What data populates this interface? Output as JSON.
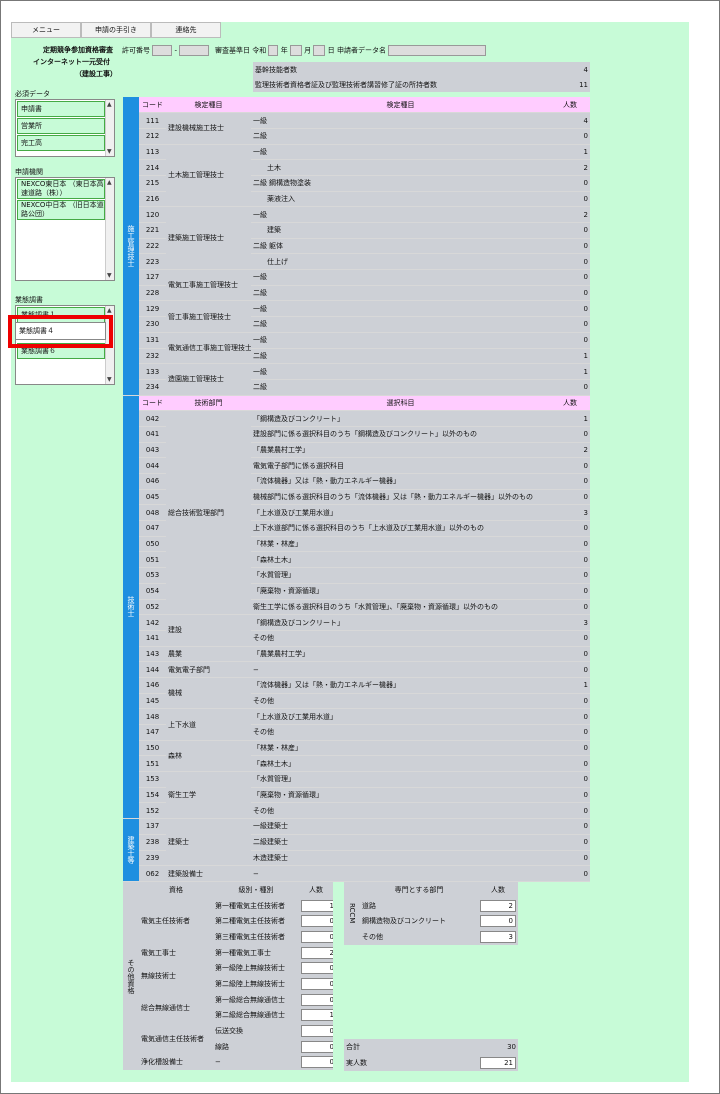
{
  "menu": {
    "items": [
      "メニュー",
      "申請の手引き",
      "連絡先"
    ]
  },
  "header": {
    "title1": "定期競争参加資格審査",
    "title2": "インターネット一元受付",
    "title3": "（建設工事）",
    "permit_label": "許可番号",
    "dash": "-",
    "kijun_label": "審査基準日",
    "era": "令和",
    "year": "年",
    "month": "月",
    "day": "日",
    "applicant_label": "申請者データ名"
  },
  "sidebar": {
    "required_label": "必須データ",
    "required_items": [
      "申請書",
      "営業所",
      "完工高"
    ],
    "agency_label": "申請機関",
    "agency_items": [
      "NEXCO東日本 （東日本高速道路（株））",
      "NEXCO中日本 （旧日本道路公団）"
    ],
    "survey_label": "業態調書",
    "survey_items": [
      "業態調書１",
      "業態調書４",
      "業態調書６"
    ]
  },
  "summary": [
    {
      "label": "基幹技能者数",
      "value": "4"
    },
    {
      "label": "監理技術者資格者証及び監理技術者講習修了証の所持者数",
      "value": "11"
    }
  ],
  "sec1": {
    "vertical": "施工管理技士",
    "headers": [
      "コード",
      "検定種目",
      "検定種目",
      "人数"
    ],
    "rows": [
      {
        "code": "111",
        "name": "建設機械施工技士",
        "span": 2,
        "sub": "一級",
        "grade": "",
        "count": "4"
      },
      {
        "code": "212",
        "sub": "二級",
        "grade": "",
        "count": "0"
      },
      {
        "code": "113",
        "name": "土木施工管理技士",
        "span": 4,
        "sub": "一級",
        "grade": "",
        "count": "1"
      },
      {
        "code": "214",
        "sub": "",
        "grade": "土木",
        "count": "2"
      },
      {
        "code": "215",
        "sub": "二級",
        "grade": "鋼構造物塗装",
        "count": "0"
      },
      {
        "code": "216",
        "sub": "",
        "grade": "薬液注入",
        "count": "0"
      },
      {
        "code": "120",
        "name": "建築施工管理技士",
        "span": 4,
        "sub": "一級",
        "grade": "",
        "count": "2"
      },
      {
        "code": "221",
        "sub": "",
        "grade": "建築",
        "count": "0"
      },
      {
        "code": "222",
        "sub": "二級",
        "grade": "躯体",
        "count": "0"
      },
      {
        "code": "223",
        "sub": "",
        "grade": "仕上げ",
        "count": "0"
      },
      {
        "code": "127",
        "name": "電気工事施工管理技士",
        "span": 2,
        "sub": "一級",
        "grade": "",
        "count": "0"
      },
      {
        "code": "228",
        "sub": "二級",
        "grade": "",
        "count": "0"
      },
      {
        "code": "129",
        "name": "管工事施工管理技士",
        "span": 2,
        "sub": "一級",
        "grade": "",
        "count": "0"
      },
      {
        "code": "230",
        "sub": "二級",
        "grade": "",
        "count": "0"
      },
      {
        "code": "131",
        "name": "電気通信工事施工管理技士",
        "span": 2,
        "sub": "一級",
        "grade": "",
        "count": "0"
      },
      {
        "code": "232",
        "sub": "二級",
        "grade": "",
        "count": "1"
      },
      {
        "code": "133",
        "name": "造園施工管理技士",
        "span": 2,
        "sub": "一級",
        "grade": "",
        "count": "1"
      },
      {
        "code": "234",
        "sub": "二級",
        "grade": "",
        "count": "0"
      }
    ]
  },
  "sec2": {
    "vertical": "技術士",
    "headers": [
      "コード",
      "技術部門",
      "選択科目",
      "人数"
    ],
    "rows": [
      {
        "code": "042",
        "name": "総合技術監理部門",
        "span": 13,
        "subject": "「鋼構造及びコンクリート」",
        "count": "1"
      },
      {
        "code": "041",
        "subject": "建設部門に係る選択科目のうち「鋼構造及びコンクリート」以外のもの",
        "count": "0"
      },
      {
        "code": "043",
        "subject": "「農業農村工学」",
        "count": "2"
      },
      {
        "code": "044",
        "subject": "電気電子部門に係る選択科目",
        "count": "0"
      },
      {
        "code": "046",
        "subject": "「流体機器」又は「熱・動力エネルギー機器」",
        "count": "0"
      },
      {
        "code": "045",
        "subject": "機械部門に係る選択科目のうち「流体機器」又は「熱・動力エネルギー機器」以外のもの",
        "count": "0"
      },
      {
        "code": "048",
        "subject": "「上水道及び工業用水道」",
        "count": "3"
      },
      {
        "code": "047",
        "subject": "上下水道部門に係る選択科目のうち「上水道及び工業用水道」以外のもの",
        "count": "0"
      },
      {
        "code": "050",
        "subject": "「林業・林産」",
        "count": "0"
      },
      {
        "code": "051",
        "subject": "「森林土木」",
        "count": "0"
      },
      {
        "code": "053",
        "subject": "「水質管理」",
        "count": "0"
      },
      {
        "code": "054",
        "subject": "「廃棄物・資源循環」",
        "count": "0"
      },
      {
        "code": "052",
        "subject": "衛生工学に係る選択科目のうち「水質管理」、「廃棄物・資源循環」以外のもの",
        "count": "0"
      },
      {
        "code": "142",
        "name": "建設",
        "span": 2,
        "subject": "「鋼構造及びコンクリート」",
        "count": "3"
      },
      {
        "code": "141",
        "subject": "その他",
        "count": "0"
      },
      {
        "code": "143",
        "name": "農業",
        "span": 1,
        "subject": "「農業農村工学」",
        "count": "0"
      },
      {
        "code": "144",
        "name": "電気電子部門",
        "span": 1,
        "subject": "−",
        "count": "0"
      },
      {
        "code": "146",
        "name": "機械",
        "span": 2,
        "subject": "「流体機器」又は「熱・動力エネルギー機器」",
        "count": "1"
      },
      {
        "code": "145",
        "subject": "その他",
        "count": "0"
      },
      {
        "code": "148",
        "name": "上下水道",
        "span": 2,
        "subject": "「上水道及び工業用水道」",
        "count": "0"
      },
      {
        "code": "147",
        "subject": "その他",
        "count": "0"
      },
      {
        "code": "150",
        "name": "森林",
        "span": 2,
        "subject": "「林業・林産」",
        "count": "0"
      },
      {
        "code": "151",
        "subject": "「森林土木」",
        "count": "0"
      },
      {
        "code": "153",
        "name": "衛生工学",
        "span": 3,
        "subject": "「水質管理」",
        "count": "0"
      },
      {
        "code": "154",
        "subject": "「廃棄物・資源循環」",
        "count": "0"
      },
      {
        "code": "152",
        "subject": "その他",
        "count": "0"
      }
    ]
  },
  "sec3": {
    "vertical": "建築士等",
    "rows": [
      {
        "code": "137",
        "name": "建築士",
        "span": 3,
        "subject": "一級建築士",
        "count": "0"
      },
      {
        "code": "238",
        "subject": "二級建築士",
        "count": "0"
      },
      {
        "code": "239",
        "subject": "木造建築士",
        "count": "0"
      },
      {
        "code": "062",
        "name": "建築設備士",
        "span": 1,
        "subject": "−",
        "count": "0"
      }
    ]
  },
  "other": {
    "vertical": "その他資格",
    "headers": [
      "資格",
      "級別・種別",
      "人数"
    ],
    "rows": [
      {
        "name": "電気主任技術者",
        "span": 3,
        "kind": "第一種電気主任技術者",
        "value": "1"
      },
      {
        "kind": "第二種電気主任技術者",
        "value": "0"
      },
      {
        "kind": "第三種電気主任技術者",
        "value": "0"
      },
      {
        "name": "電気工事士",
        "span": 1,
        "kind": "第一種電気工事士",
        "value": "2"
      },
      {
        "name": "無線技術士",
        "span": 2,
        "kind": "第一級陸上無線技術士",
        "value": "0"
      },
      {
        "kind": "第二級陸上無線技術士",
        "value": "0"
      },
      {
        "name": "総合無線通信士",
        "span": 2,
        "kind": "第一級総合無線通信士",
        "value": "0"
      },
      {
        "kind": "第二級総合無線通信士",
        "value": "1"
      },
      {
        "name": "電気通信主任技術者",
        "span": 2,
        "kind": "伝送交換",
        "value": "0"
      },
      {
        "kind": "線路",
        "value": "0"
      },
      {
        "name": "浄化槽設備士",
        "span": 1,
        "kind": "−",
        "value": "0"
      }
    ]
  },
  "rccm": {
    "vertical": "RCCM",
    "headers": [
      "専門とする部門",
      "人数"
    ],
    "rows": [
      {
        "name": "道路",
        "value": "2"
      },
      {
        "name": "鋼構造物及びコンクリート",
        "value": "0"
      },
      {
        "name": "その他",
        "value": "3"
      }
    ]
  },
  "totals": {
    "sum_label": "合計",
    "sum_value": "30",
    "real_label": "実人数",
    "real_value": "21"
  }
}
